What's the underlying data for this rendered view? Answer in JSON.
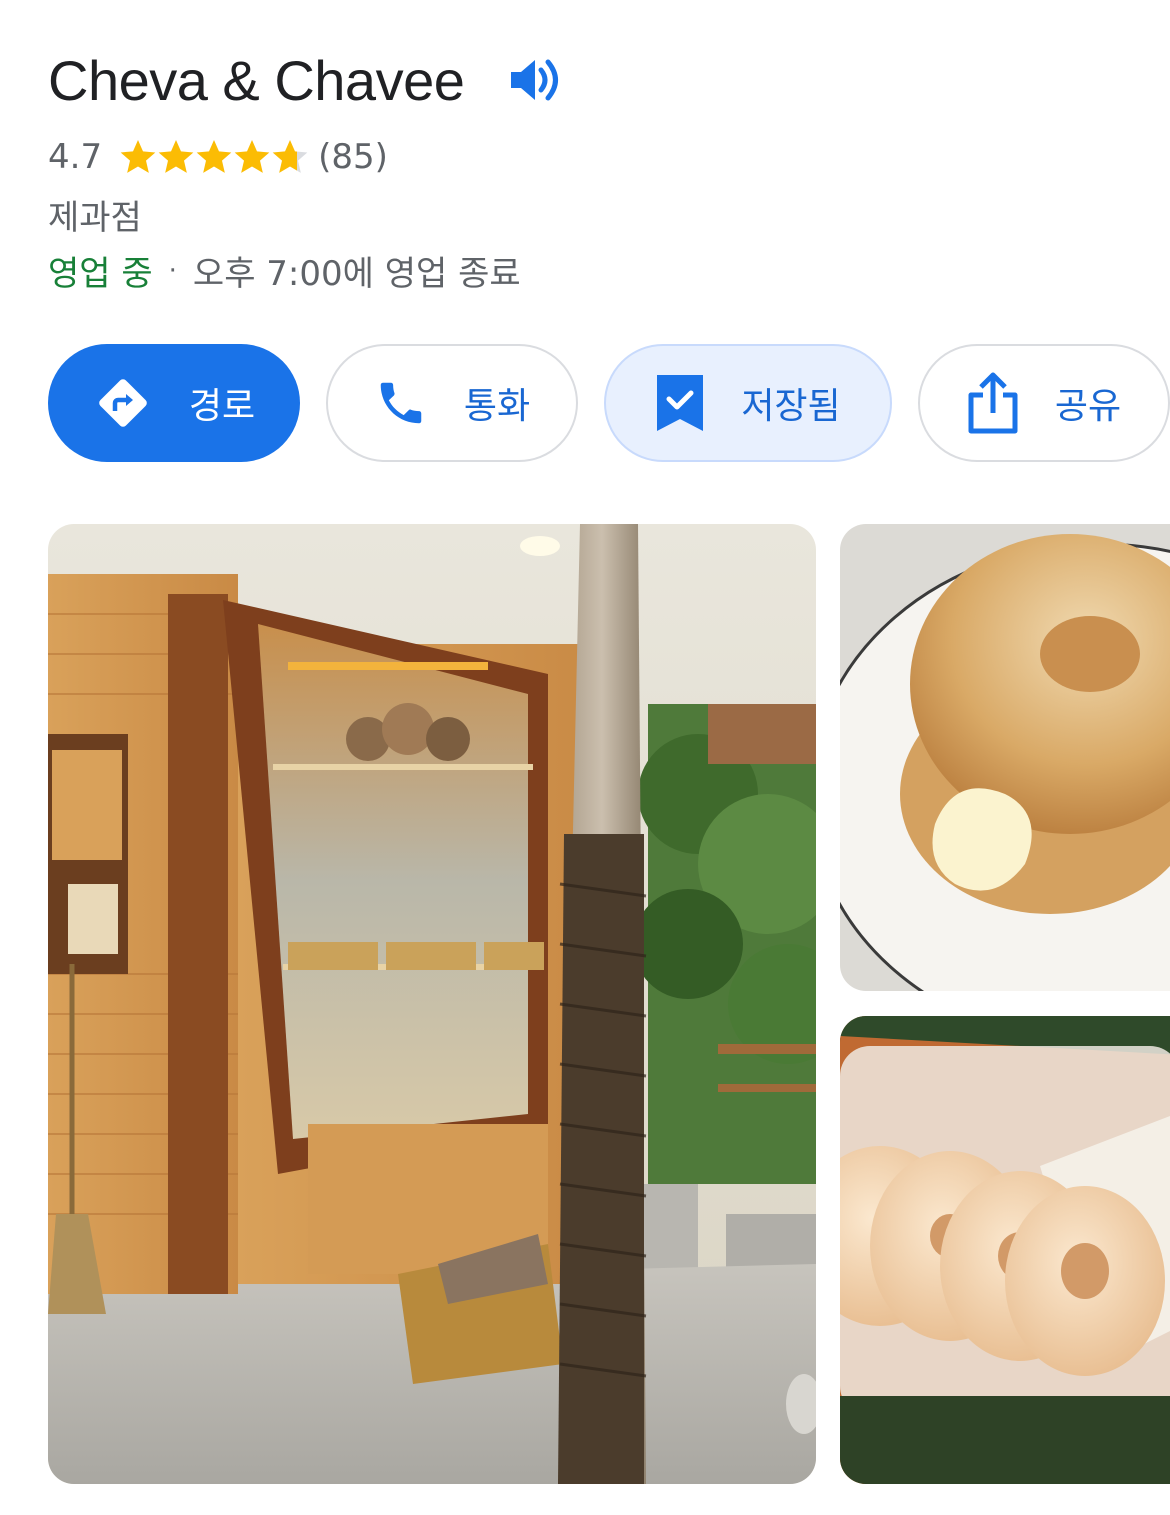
{
  "place": {
    "name": "Cheva & Chavee",
    "rating": "4.7",
    "rating_value": 4.7,
    "review_count": "(85)",
    "category": "제과점",
    "status_open": "영업 중",
    "separator": "·",
    "closing_info": "오후 7:00에 영업 종료"
  },
  "icons": {
    "speaker": "speaker-icon",
    "star": "star-icon",
    "directions": "directions-icon",
    "phone": "phone-icon",
    "bookmark": "bookmark-check-icon",
    "share": "share-icon"
  },
  "actions": {
    "directions_label": "경로",
    "call_label": "통화",
    "saved_label": "저장됨",
    "share_label": "공유"
  },
  "colors": {
    "accent": "#1a73e8",
    "open_green": "#188038",
    "star": "#fbbc04",
    "secondary_text": "#5f6368"
  }
}
